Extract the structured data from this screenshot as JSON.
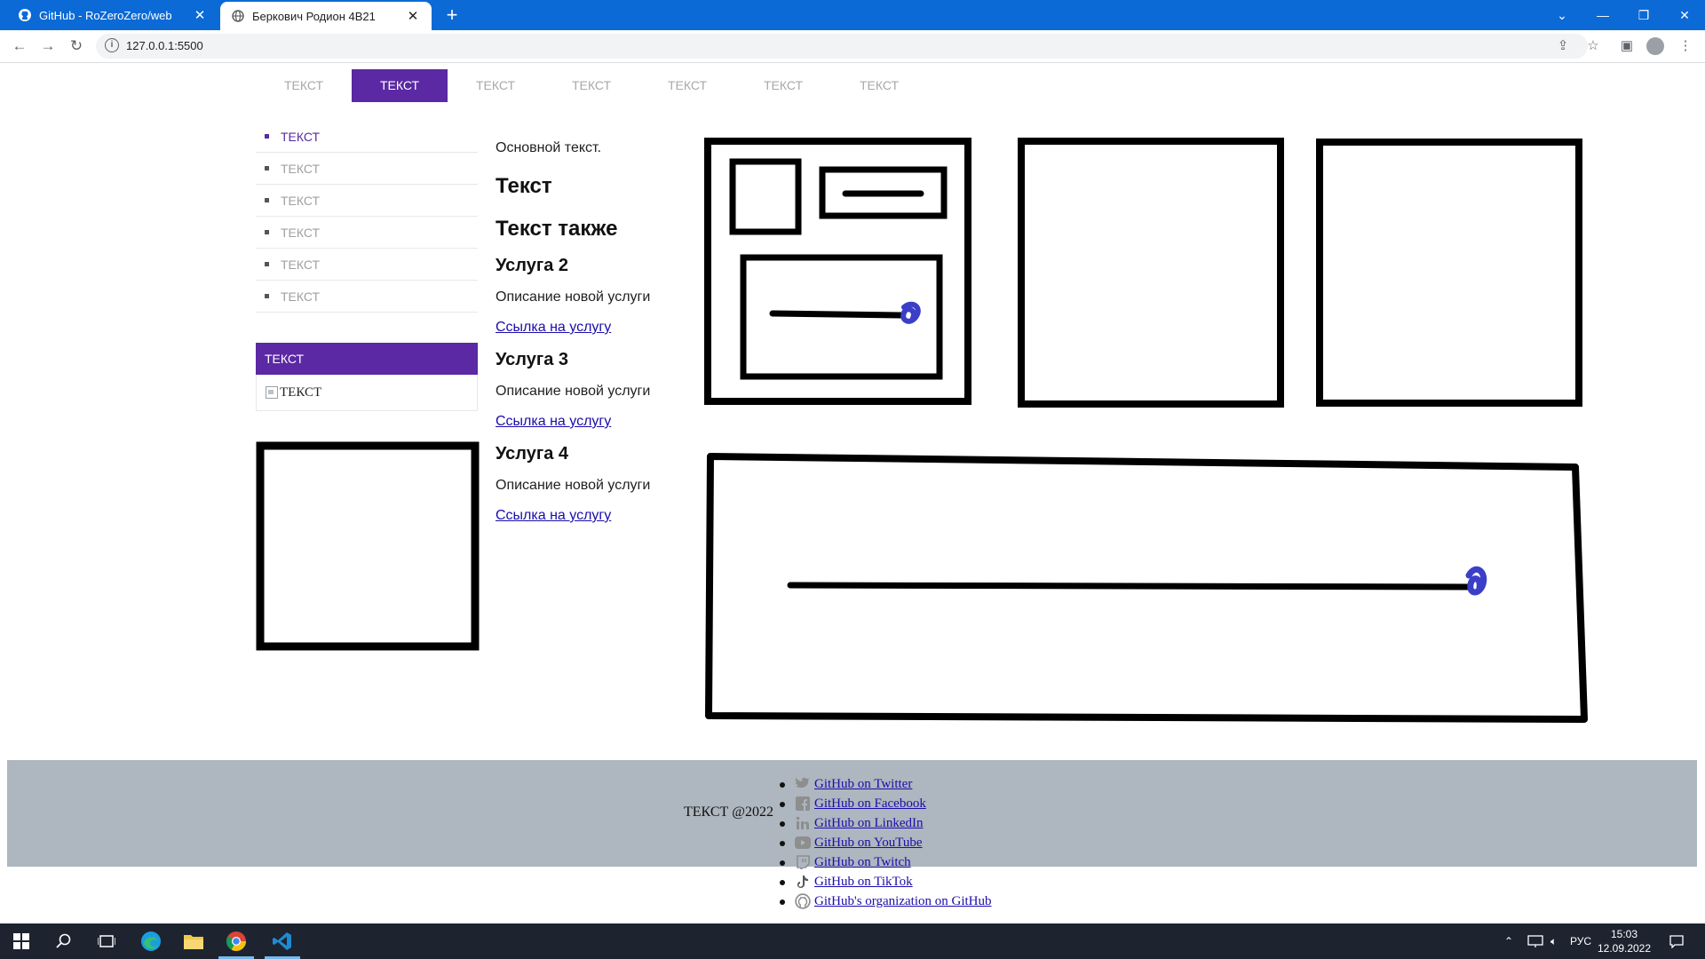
{
  "browser": {
    "tabs": [
      {
        "title": "GitHub - RoZeroZero/web",
        "active": false,
        "icon": "github-icon"
      },
      {
        "title": "Беркович Родион 4В21",
        "active": true,
        "icon": "globe-icon"
      }
    ],
    "url": "127.0.0.1:5500"
  },
  "page": {
    "topnav": [
      "ТЕКСТ",
      "ТЕКСТ",
      "ТЕКСТ",
      "ТЕКСТ",
      "ТЕКСТ",
      "ТЕКСТ",
      "ТЕКСТ"
    ],
    "topnav_active_index": 1,
    "sidebar": {
      "items": [
        "ТЕКСТ",
        "ТЕКСТ",
        "ТЕКСТ",
        "ТЕКСТ",
        "ТЕКСТ",
        "ТЕКСТ"
      ],
      "active_index": 0,
      "panel_title": "ТЕКСТ",
      "panel_image_alt": "ТЕКСТ"
    },
    "content": {
      "intro": "Основной текст.",
      "heading1": "Текст",
      "heading2": "Текст также",
      "services": [
        {
          "title": "Услуга 2",
          "desc": "Описание новой услуги",
          "link": "Ссылка на услугу"
        },
        {
          "title": "Услуга 3",
          "desc": "Описание новой услуги",
          "link": "Ссылка на услугу"
        },
        {
          "title": "Услуга 4",
          "desc": "Описание новой услуги",
          "link": "Ссылка на услугу"
        }
      ]
    },
    "footer": {
      "text": "ТЕКСТ @2022",
      "links": [
        {
          "label": " GitHub on Twitter",
          "icon": "twitter-icon"
        },
        {
          "label": " GitHub on Facebook",
          "icon": "facebook-icon"
        },
        {
          "label": " GitHub on LinkedIn",
          "icon": "linkedin-icon"
        },
        {
          "label": " GitHub on YouTube",
          "icon": "youtube-icon"
        },
        {
          "label": " GitHub on Twitch",
          "icon": "twitch-icon"
        },
        {
          "label": " GitHub on TikTok",
          "icon": "tiktok-icon"
        },
        {
          "label": " GitHub's organization on GitHub",
          "icon": "github-icon"
        }
      ]
    },
    "colors": {
      "accent": "#5a29a3",
      "footer_bg": "#aeb6bf",
      "link": "#1a0dab",
      "sketch_accent": "#3b3fc8"
    }
  },
  "taskbar": {
    "language": "РУС",
    "time": "15:03",
    "date": "12.09.2022"
  }
}
